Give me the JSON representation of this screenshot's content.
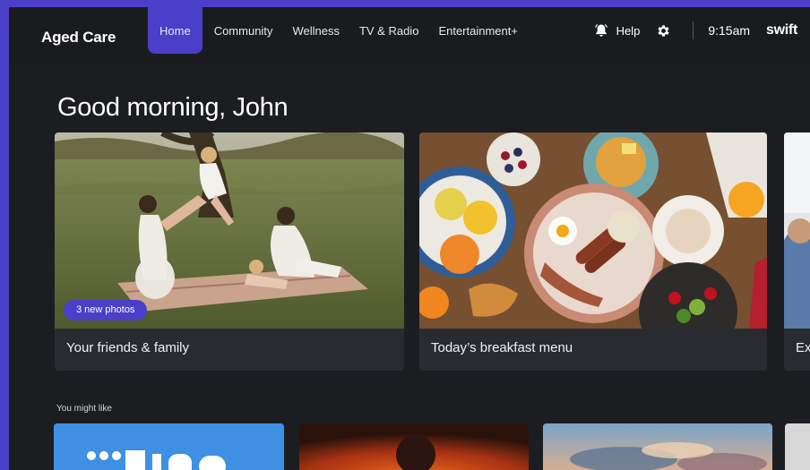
{
  "app": {
    "brand": "Aged Care",
    "logo": "swift"
  },
  "nav": {
    "items": [
      {
        "label": "Home",
        "active": true
      },
      {
        "label": "Community"
      },
      {
        "label": "Wellness"
      },
      {
        "label": "TV & Radio"
      },
      {
        "label": "Entertainment+"
      }
    ]
  },
  "toolbar": {
    "help_label": "Help",
    "help_icon": "bell-icon",
    "settings_icon": "gear-icon",
    "time": "9:15am"
  },
  "main": {
    "greeting": "Good morning, John",
    "cards": [
      {
        "caption": "Your friends & family",
        "badge": "3 new photos"
      },
      {
        "caption": "Today’s breakfast menu"
      },
      {
        "caption": "Ex"
      }
    ],
    "section_label": "You might like"
  },
  "colors": {
    "accent": "#4a3fc9",
    "background": "#1c1d21",
    "card": "#2a2b30"
  }
}
